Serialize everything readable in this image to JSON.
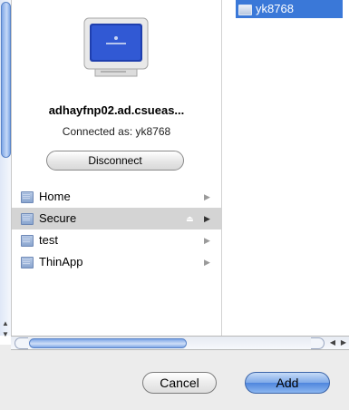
{
  "server": {
    "name": "adhayfnp02.ad.csueas...",
    "connected_as": "Connected as: yk8768",
    "disconnect_label": "Disconnect"
  },
  "list": {
    "items": [
      {
        "label": "Home",
        "selected": false
      },
      {
        "label": "Secure",
        "selected": true
      },
      {
        "label": "test",
        "selected": false
      },
      {
        "label": "ThinApp",
        "selected": false
      }
    ]
  },
  "column2": {
    "selected_item": "yk8768"
  },
  "icons": {
    "computer": "computer-monitor-icon",
    "folder": "folder-icon",
    "chevron": "chevron-right-icon",
    "eject": "eject-icon"
  },
  "buttons": {
    "cancel_label": "Cancel",
    "add_label": "Add"
  },
  "colors": {
    "selection_blue": "#3a78d8",
    "list_selected": "#d4d4d4"
  }
}
